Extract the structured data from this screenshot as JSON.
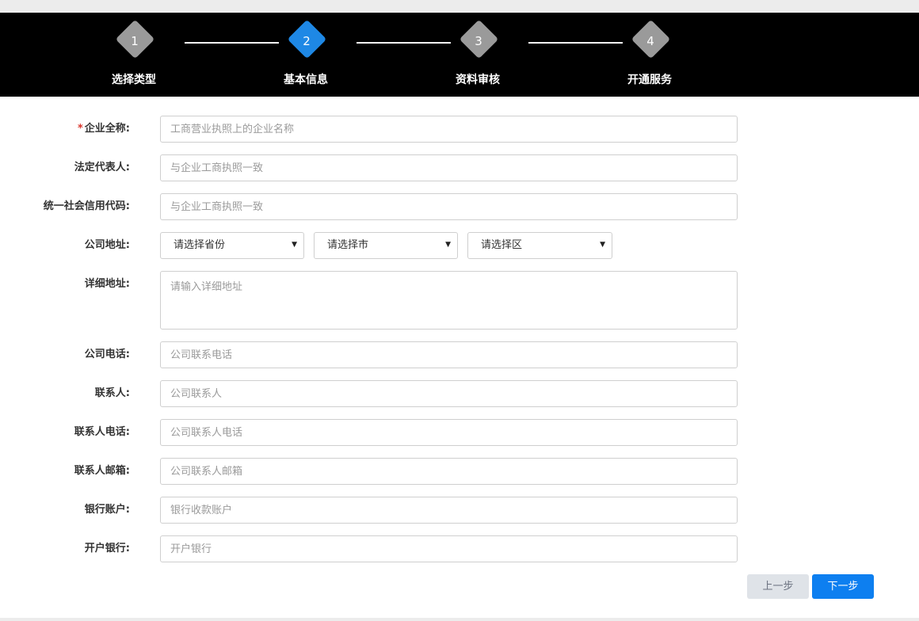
{
  "stepper": {
    "steps": [
      {
        "num": "1",
        "label": "选择类型"
      },
      {
        "num": "2",
        "label": "基本信息"
      },
      {
        "num": "3",
        "label": "资料审核"
      },
      {
        "num": "4",
        "label": "开通服务"
      }
    ],
    "active_step": 2,
    "colors": {
      "active": "#1e88e5",
      "inactive": "#9a9a9a",
      "bar": "#000000"
    }
  },
  "form": {
    "company_name": {
      "label": "企业全称:",
      "required_mark": "*",
      "placeholder": "工商营业执照上的企业名称"
    },
    "legal_rep": {
      "label": "法定代表人:",
      "placeholder": "与企业工商执照一致"
    },
    "credit_code": {
      "label": "统一社会信用代码:",
      "placeholder": "与企业工商执照一致"
    },
    "address": {
      "label": "公司地址:",
      "province": "请选择省份",
      "city": "请选择市",
      "district": "请选择区"
    },
    "detail_address": {
      "label": "详细地址:",
      "placeholder": "请输入详细地址"
    },
    "company_phone": {
      "label": "公司电话:",
      "placeholder": "公司联系电话"
    },
    "contact": {
      "label": "联系人:",
      "placeholder": "公司联系人"
    },
    "contact_phone": {
      "label": "联系人电话:",
      "placeholder": "公司联系人电话"
    },
    "contact_email": {
      "label": "联系人邮箱:",
      "placeholder": "公司联系人邮箱"
    },
    "bank_account": {
      "label": "银行账户:",
      "placeholder": "银行收款账户"
    },
    "bank_name": {
      "label": "开户银行:",
      "placeholder": "开户银行"
    }
  },
  "actions": {
    "prev_label": "上一步",
    "next_label": "下一步"
  },
  "select_caret": "▼"
}
